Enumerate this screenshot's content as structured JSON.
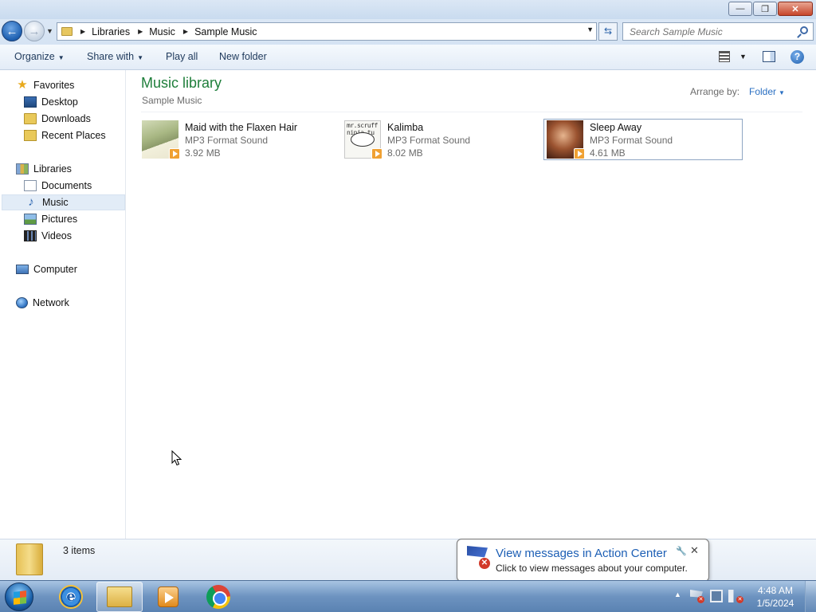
{
  "window": {
    "buttons": {
      "minimize": "—",
      "maximize": "❐",
      "close": "✕"
    }
  },
  "address": {
    "crumbs": [
      "Libraries",
      "Music",
      "Sample Music"
    ],
    "search_placeholder": "Search Sample Music"
  },
  "toolbar": {
    "organize": "Organize",
    "share_with": "Share with",
    "play_all": "Play all",
    "new_folder": "New folder"
  },
  "sidebar": {
    "favorites": "Favorites",
    "desktop": "Desktop",
    "downloads": "Downloads",
    "recent_places": "Recent Places",
    "libraries": "Libraries",
    "documents": "Documents",
    "music": "Music",
    "pictures": "Pictures",
    "videos": "Videos",
    "computer": "Computer",
    "network": "Network"
  },
  "library": {
    "title": "Music library",
    "subtitle": "Sample Music",
    "arrange_label": "Arrange by:",
    "arrange_value": "Folder"
  },
  "files": [
    {
      "name": "Maid with the Flaxen Hair",
      "type": "MP3 Format Sound",
      "size": "3.92 MB"
    },
    {
      "name": "Kalimba",
      "type": "MP3 Format Sound",
      "size": "8.02 MB",
      "thumb_text": "mr.scruff ninja tu"
    },
    {
      "name": "Sleep Away",
      "type": "MP3 Format Sound",
      "size": "4.61 MB"
    }
  ],
  "details": {
    "item_count": "3 items"
  },
  "notification": {
    "title": "View messages in Action Center",
    "text": "Click to view messages about your computer."
  },
  "taskbar": {
    "time": "4:48 AM",
    "date": "1/5/2024"
  },
  "colors": {
    "library_title": "#1e7e3a",
    "link_blue": "#2a6fc2",
    "notification_title": "#1d5fb5"
  }
}
